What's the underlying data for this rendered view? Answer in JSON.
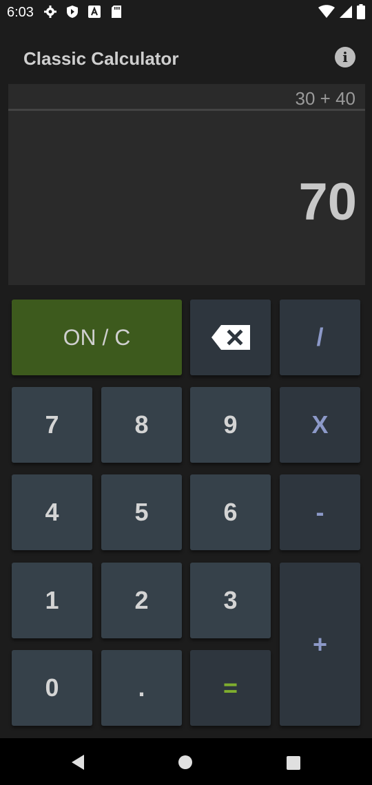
{
  "status_bar": {
    "time": "6:03",
    "icons_left": [
      "settings-icon",
      "shield-icon",
      "a-badge-icon",
      "sd-card-icon"
    ],
    "icons_right": [
      "wifi-icon",
      "signal-icon",
      "battery-icon"
    ]
  },
  "app": {
    "title": "Classic Calculator",
    "info_label": "i"
  },
  "display": {
    "expression": "30 + 40",
    "result": "70"
  },
  "keys": {
    "clear": "ON / C",
    "divide": "/",
    "seven": "7",
    "eight": "8",
    "nine": "9",
    "multiply": "X",
    "four": "4",
    "five": "5",
    "six": "6",
    "minus": "-",
    "one": "1",
    "two": "2",
    "three": "3",
    "plus": "+",
    "zero": "0",
    "decimal": ".",
    "equals": "="
  },
  "colors": {
    "background": "#1c1c1c",
    "display": "#2a2a2a",
    "number_key": "#36414a",
    "operator_key": "#2e363e",
    "clear_key": "#3d5a1d",
    "operator_text": "#8c99c8",
    "equals_text": "#7fae2e"
  }
}
